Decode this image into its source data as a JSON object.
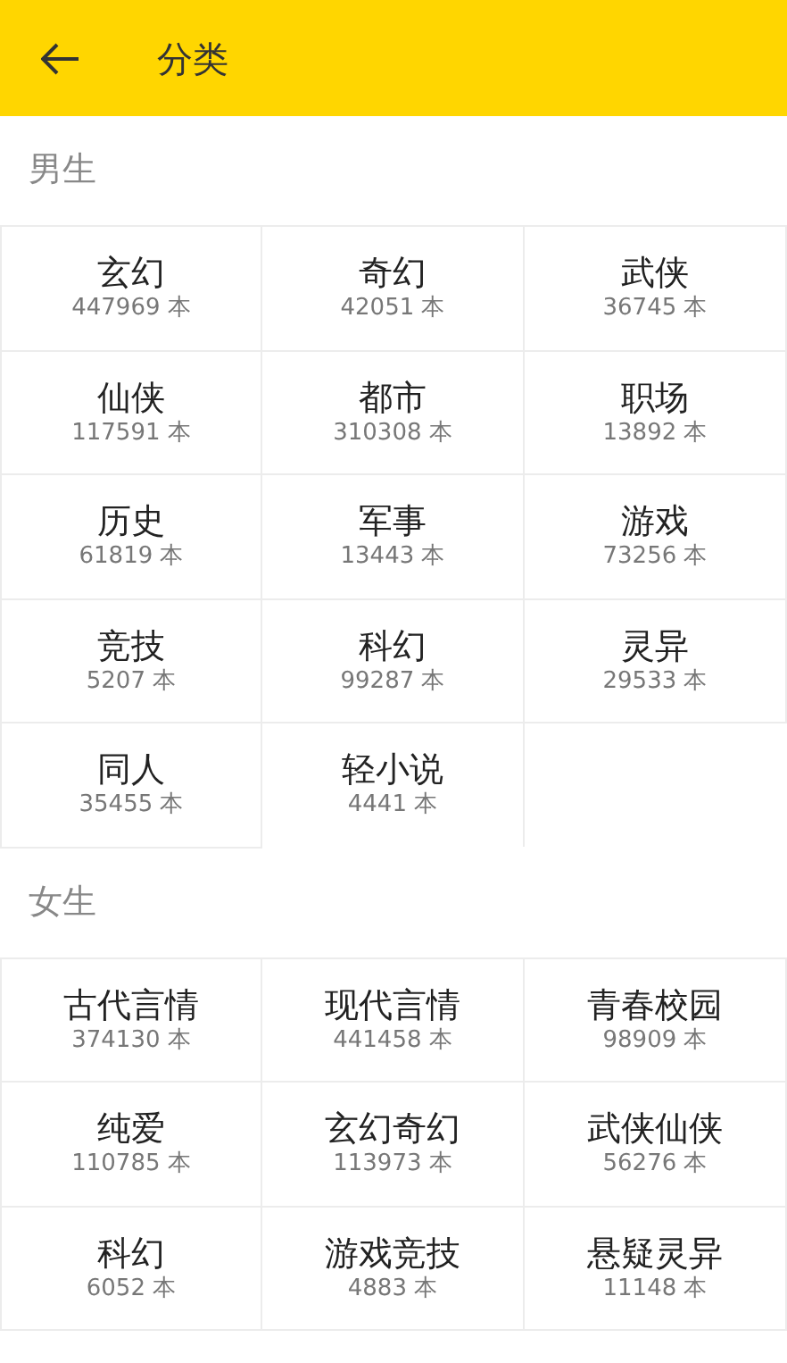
{
  "app_bar": {
    "title": "分类"
  },
  "sections": [
    {
      "title": "男生",
      "categories": [
        {
          "name": "玄幻",
          "count": "447969 本"
        },
        {
          "name": "奇幻",
          "count": "42051 本"
        },
        {
          "name": "武侠",
          "count": "36745 本"
        },
        {
          "name": "仙侠",
          "count": "117591 本"
        },
        {
          "name": "都市",
          "count": "310308 本"
        },
        {
          "name": "职场",
          "count": "13892 本"
        },
        {
          "name": "历史",
          "count": "61819 本"
        },
        {
          "name": "军事",
          "count": "13443 本"
        },
        {
          "name": "游戏",
          "count": "73256 本"
        },
        {
          "name": "竞技",
          "count": "5207 本"
        },
        {
          "name": "科幻",
          "count": "99287 本"
        },
        {
          "name": "灵异",
          "count": "29533 本"
        },
        {
          "name": "同人",
          "count": "35455 本"
        },
        {
          "name": "轻小说",
          "count": "4441 本"
        }
      ]
    },
    {
      "title": "女生",
      "categories": [
        {
          "name": "古代言情",
          "count": "374130 本"
        },
        {
          "name": "现代言情",
          "count": "441458 本"
        },
        {
          "name": "青春校园",
          "count": "98909 本"
        },
        {
          "name": "纯爱",
          "count": "110785 本"
        },
        {
          "name": "玄幻奇幻",
          "count": "113973 本"
        },
        {
          "name": "武侠仙侠",
          "count": "56276 本"
        },
        {
          "name": "科幻",
          "count": "6052 本"
        },
        {
          "name": "游戏竞技",
          "count": "4883 本"
        },
        {
          "name": "悬疑灵异",
          "count": "11148 本"
        }
      ]
    }
  ]
}
